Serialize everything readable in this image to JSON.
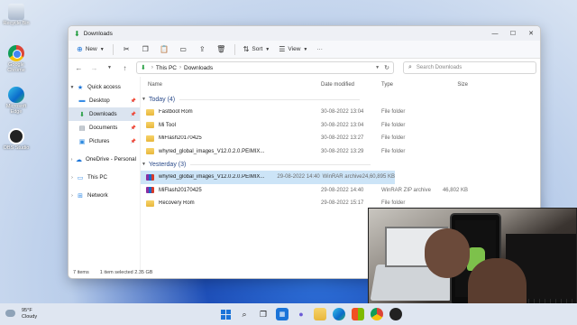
{
  "desktop": {
    "icons": [
      {
        "label": "Recycle Bin",
        "icon": "recycle-bin-icon"
      },
      {
        "label": "Google Chrome",
        "icon": "chrome-icon"
      },
      {
        "label": "Microsoft Edge",
        "icon": "edge-icon"
      },
      {
        "label": "OBS Studio",
        "icon": "obs-icon"
      }
    ]
  },
  "window": {
    "title": "Downloads"
  },
  "toolbar": {
    "new_label": "New",
    "sort_label": "Sort",
    "view_label": "View",
    "more_label": "···"
  },
  "address": {
    "path": [
      "This PC",
      "Downloads"
    ],
    "search_placeholder": "Search Downloads"
  },
  "sidebar": {
    "items": [
      {
        "label": "Quick access",
        "icon": "star-icon"
      },
      {
        "label": "Desktop",
        "icon": "desktop-icon"
      },
      {
        "label": "Downloads",
        "icon": "download-icon"
      },
      {
        "label": "Documents",
        "icon": "documents-icon"
      },
      {
        "label": "Pictures",
        "icon": "pictures-icon"
      },
      {
        "label": "OneDrive - Personal",
        "icon": "cloud-icon"
      },
      {
        "label": "This PC",
        "icon": "pc-icon"
      },
      {
        "label": "Network",
        "icon": "network-icon"
      }
    ]
  },
  "columns": {
    "name": "Name",
    "date": "Date modified",
    "type": "Type",
    "size": "Size"
  },
  "groups": [
    {
      "label": "Today (4)",
      "rows": [
        {
          "name": "Fastboot Rom",
          "date": "30-08-2022 13:04",
          "type": "File folder",
          "size": ""
        },
        {
          "name": "Mi Tool",
          "date": "30-08-2022 13:04",
          "type": "File folder",
          "size": ""
        },
        {
          "name": "MiFlash20170425",
          "date": "30-08-2022 13:27",
          "type": "File folder",
          "size": ""
        },
        {
          "name": "whyred_global_images_V12.0.2.0.PEIMIX...",
          "date": "30-08-2022 13:29",
          "type": "File folder",
          "size": ""
        }
      ]
    },
    {
      "label": "Yesterday (3)",
      "rows": [
        {
          "name": "whyred_global_images_V12.0.2.0.PEIMIX...",
          "date": "29-08-2022 14:40",
          "type": "WinRAR archive",
          "size": "24,60,895 KB"
        },
        {
          "name": "MiFlash20170425",
          "date": "29-08-2022 14:40",
          "type": "WinRAR ZIP archive",
          "size": "46,802 KB"
        },
        {
          "name": "Recovery Rom",
          "date": "29-08-2022 15:17",
          "type": "File folder",
          "size": ""
        }
      ]
    }
  ],
  "status": {
    "items": "7 items",
    "selected": "1 item selected  2.35 GB"
  },
  "taskbar": {
    "temp": "95°F",
    "condition": "Cloudy"
  }
}
